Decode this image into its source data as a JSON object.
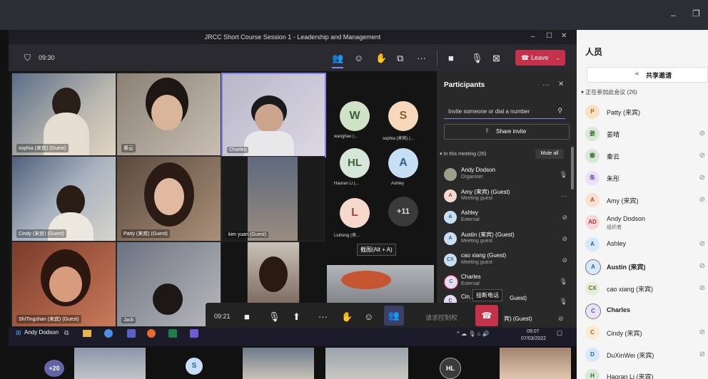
{
  "window_title": "JRCC Short Course Session 1 - Leadership and Management",
  "meeting_timer": "09:30",
  "leave_label": "Leave",
  "tiles": [
    {
      "name": "sophia (来宾) (Guest)"
    },
    {
      "name": "秦云"
    },
    {
      "name": "Charles"
    },
    {
      "name": "Cindy (来宾) (Guest)"
    },
    {
      "name": "Patty (来宾) (Guest)"
    },
    {
      "name": "kim yuan (Guest)"
    },
    {
      "name": "ShiTingshan (来宾) (Guest)"
    },
    {
      "name": "Jack"
    }
  ],
  "avatar_grid": [
    {
      "initials": "W",
      "name": "wanghao (..."
    },
    {
      "initials": "S",
      "name": "sophia (来宾) (..."
    },
    {
      "initials": "HL",
      "name": "Haoran Li (..."
    },
    {
      "initials": "A",
      "name": "Ashley"
    },
    {
      "initials": "L",
      "name": "Liuheng (来..."
    },
    {
      "initials": "+11",
      "name": ""
    }
  ],
  "screenshot_tooltip": "截图(Alt + A)",
  "participants_panel": {
    "title": "Participants",
    "invite_placeholder": "Invite someone or dial a number",
    "share_invite": "Share invite",
    "section": "In this meeting (26)",
    "mute_all": "Mute all",
    "rows": [
      {
        "initials": "",
        "name": "Andy Dodson",
        "role": "Organiser"
      },
      {
        "initials": "A",
        "name": "Amy (来宾) (Guest)",
        "role": "Meeting guest"
      },
      {
        "initials": "A",
        "name": "Ashley",
        "role": "External"
      },
      {
        "initials": "A",
        "name": "Austin (来宾) (Guest)",
        "role": "Meeting guest"
      },
      {
        "initials": "CX",
        "name": "cao xiang (Guest)",
        "role": "Meeting guest"
      },
      {
        "initials": "C",
        "name": "Charles",
        "role": "External"
      },
      {
        "initials": "C",
        "name": "Cin...",
        "role": ""
      }
    ]
  },
  "hangup_tooltip": "挂断电话",
  "partial_row_tail": "Guest)",
  "meeting_bar": {
    "time": "09:21",
    "request_control": "请求控制权",
    "partial_guest": "宾) (Guest)"
  },
  "taskbar": {
    "label": "Andy Dodson",
    "time": "09:07",
    "date": "07/03/2022"
  },
  "bottom_strip": {
    "overflow": "+20",
    "s_initial": "S",
    "hl_initial": "HL"
  },
  "right_pane": {
    "title": "人员",
    "share_invite": "共享邀请",
    "section": "正在参加此会议 (26)",
    "rows": [
      {
        "initials": "P",
        "name": "Patty (来宾)",
        "sub": ""
      },
      {
        "initials": "姜",
        "name": "姜晴",
        "sub": ""
      },
      {
        "initials": "秦",
        "name": "秦云",
        "sub": ""
      },
      {
        "initials": "朱",
        "name": "朱彤",
        "sub": ""
      },
      {
        "initials": "A",
        "name": "Amy (来宾)",
        "sub": ""
      },
      {
        "initials": "AD",
        "name": "Andy Dodson",
        "sub": "组织者"
      },
      {
        "initials": "A",
        "name": "Ashley",
        "sub": ""
      },
      {
        "initials": "A",
        "name": "Austin (来宾)",
        "sub": ""
      },
      {
        "initials": "CX",
        "name": "cao xiang (来宾)",
        "sub": ""
      },
      {
        "initials": "C",
        "name": "Charles",
        "sub": ""
      },
      {
        "initials": "C",
        "name": "Cindy (来宾)",
        "sub": ""
      },
      {
        "initials": "D",
        "name": "DuXinWei (来宾)",
        "sub": ""
      },
      {
        "initials": "H",
        "name": "Haoran Li (来宾)",
        "sub": ""
      }
    ]
  },
  "colors": {
    "accent": "#6264a7",
    "leave": "#c4314b",
    "panel": "#292929"
  }
}
